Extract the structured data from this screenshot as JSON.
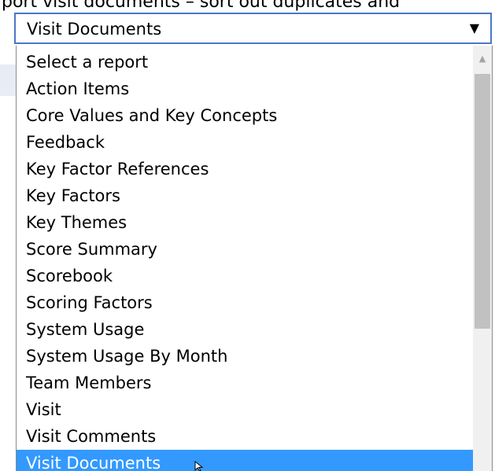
{
  "background": {
    "text": "port visit documents – sort out duplicates and"
  },
  "select": {
    "value": "Visit Documents",
    "arrow": "▼"
  },
  "dropdown": {
    "options": [
      "Select a report",
      "Action Items",
      "Core Values and Key Concepts",
      "Feedback",
      "Key Factor References",
      "Key Factors",
      "Key Themes",
      "Score Summary",
      "Scorebook",
      "Scoring Factors",
      "System Usage",
      "System Usage By Month",
      "Team Members",
      "Visit",
      "Visit Comments",
      "Visit Documents"
    ],
    "selected_index": 15,
    "scroll_up_glyph": "▲"
  },
  "colors": {
    "highlight": "#3399ff",
    "select_border": "#4a78c6"
  },
  "icons": {
    "cursor": "mouse-pointer-icon",
    "scroll_up": "chevron-up-icon",
    "dropdown_arrow": "caret-down-icon"
  }
}
